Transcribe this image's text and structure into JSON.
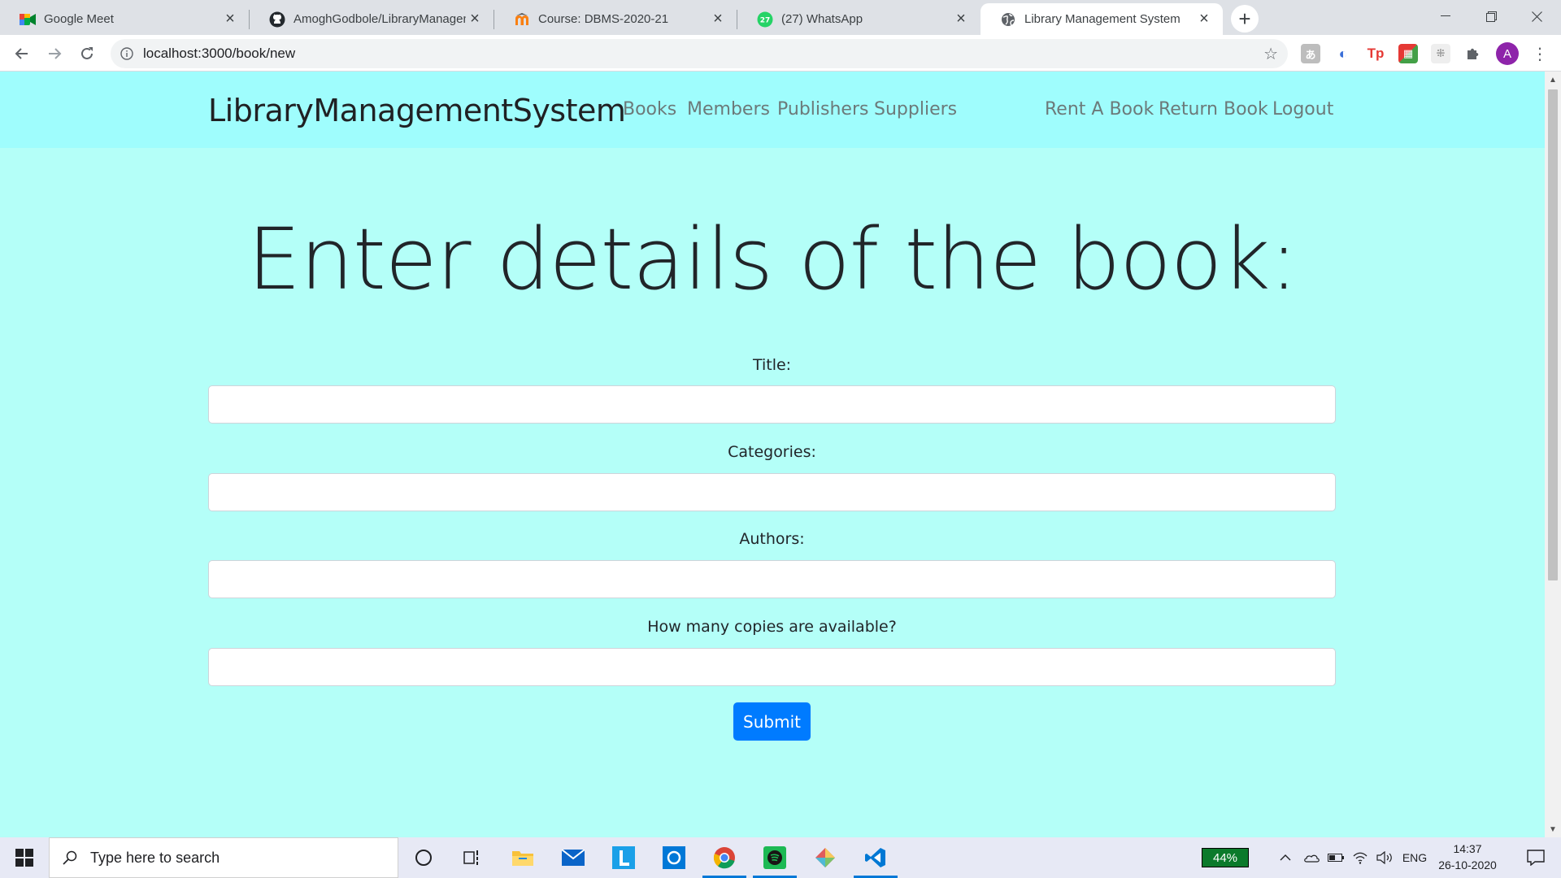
{
  "browser": {
    "tabs": [
      {
        "title": "Google Meet",
        "active": false
      },
      {
        "title": "AmoghGodbole/LibraryManagem",
        "active": false
      },
      {
        "title": "Course: DBMS-2020-21",
        "active": false
      },
      {
        "title": "(27) WhatsApp",
        "active": false,
        "badge": "27"
      },
      {
        "title": "Library Management System",
        "active": true
      }
    ],
    "url": "localhost:3000/book/new",
    "profile_initial": "A",
    "extensions": [
      "translate-ext",
      "sync-ext",
      "Tp",
      "color-ext",
      "grid-ext",
      "puzzle-icon"
    ]
  },
  "navbar": {
    "brand": "LibraryManagementSystem",
    "left_links": [
      "Books",
      "Members",
      "Publishers",
      "Suppliers"
    ],
    "right_links": [
      "Rent A Book",
      "Return Book",
      "Logout"
    ]
  },
  "form": {
    "heading": "Enter details of the book:",
    "fields": [
      {
        "label": "Title:",
        "value": ""
      },
      {
        "label": "Categories:",
        "value": ""
      },
      {
        "label": "Authors:",
        "value": ""
      },
      {
        "label": "How many copies are available?",
        "value": ""
      }
    ],
    "submit_label": "Submit"
  },
  "taskbar": {
    "search_placeholder": "Type here to search",
    "battery_percent": "44%",
    "language": "ENG",
    "time": "14:37",
    "date": "26-10-2020"
  },
  "colors": {
    "page_bg": "#b4fff8",
    "navbar_bg": "#9ffdfd",
    "primary_button": "#007bff"
  }
}
